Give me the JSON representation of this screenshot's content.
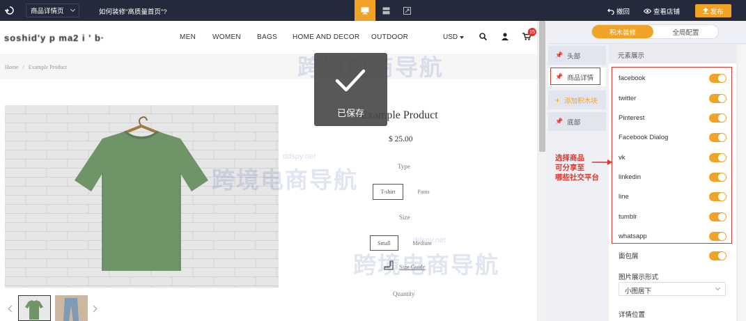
{
  "topbar": {
    "page_select": "商品详情页",
    "help_link": "如何装修\"高质量首页\"?",
    "undo": "撤回",
    "view_store": "查看店铺",
    "publish": "发布"
  },
  "store": {
    "logo": "soshid'y   p ma2 i '  b·",
    "nav": [
      "MEN",
      "WOMEN",
      "BAGS",
      "HOME AND DECOR",
      "OUTDOOR"
    ],
    "currency": "USD",
    "cart_count": "15"
  },
  "breadcrumb": {
    "home": "Home",
    "sep": "/",
    "current": "Example Product"
  },
  "toast": {
    "label": "已保存"
  },
  "product": {
    "title": "Example Product",
    "price": "$ 25.00",
    "type_label": "Type",
    "types": [
      "T-shirt",
      "Pants"
    ],
    "size_label": "Size",
    "sizes": [
      "Small",
      "Medium"
    ],
    "size_guide": "Size Guide",
    "quantity_label": "Quantity"
  },
  "panel": {
    "tabs": [
      "积木装修",
      "全局配置"
    ],
    "sections": [
      "头部",
      "商品详情",
      "添加积木块",
      "底部"
    ],
    "content_header": "元素展示",
    "social": [
      {
        "label": "facebook",
        "on": true
      },
      {
        "label": "twitter",
        "on": true
      },
      {
        "label": "Pinterest",
        "on": true
      },
      {
        "label": "Facebook Dialog",
        "on": true
      },
      {
        "label": "vk",
        "on": true
      },
      {
        "label": "linkedin",
        "on": true
      },
      {
        "label": "line",
        "on": true
      },
      {
        "label": "tumblr",
        "on": true
      },
      {
        "label": "whatsapp",
        "on": true
      }
    ],
    "breadcrumb_toggle": {
      "label": "面包屑",
      "on": true
    },
    "image_mode_label": "图片展示形式",
    "image_mode_value": "小图居下",
    "detail_position": "详情位置"
  },
  "annotation": {
    "lines": [
      "选择商品",
      "可分享至",
      "哪些社交平台"
    ]
  },
  "watermark": {
    "text": "跨境电商导航",
    "site": "ddspy.net"
  },
  "colors": {
    "accent": "#f0a327",
    "topbar": "#232a3b",
    "annotation": "#e0352b"
  }
}
